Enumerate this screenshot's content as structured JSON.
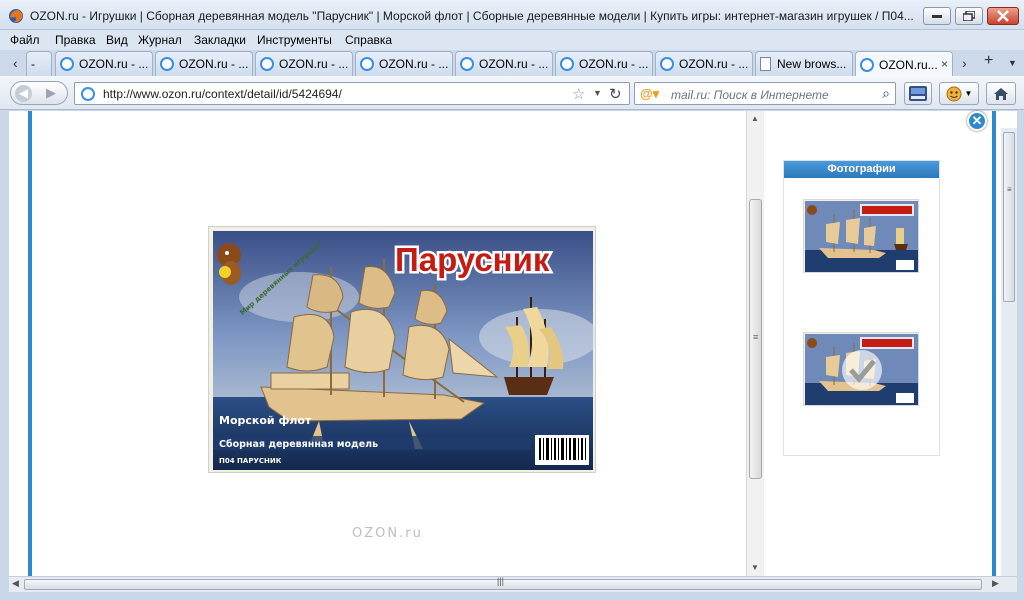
{
  "window": {
    "title": "OZON.ru - Игрушки | Сборная деревянная модель \"Парусник\" | Морской флот | Сборные деревянные модели | Купить игры: интернет-магазин игрушек / П04..."
  },
  "menu": [
    "Файл",
    "Правка",
    "Вид",
    "Журнал",
    "Закладки",
    "Инструменты",
    "Справка"
  ],
  "tabs": [
    {
      "label": "-",
      "type": "ozon"
    },
    {
      "label": "OZON.ru - ...",
      "type": "ozon"
    },
    {
      "label": "OZON.ru - ...",
      "type": "ozon"
    },
    {
      "label": "OZON.ru - ...",
      "type": "ozon"
    },
    {
      "label": "OZON.ru - ...",
      "type": "ozon"
    },
    {
      "label": "OZON.ru - ...",
      "type": "ozon"
    },
    {
      "label": "OZON.ru - ...",
      "type": "ozon"
    },
    {
      "label": "OZON.ru - ...",
      "type": "ozon"
    },
    {
      "label": "New brows...",
      "type": "doc"
    },
    {
      "label": "OZON.ru...",
      "type": "ozon",
      "active": true
    }
  ],
  "tab_controls": {
    "new_tab": "+",
    "close": "×"
  },
  "navbar": {
    "url": "http://www.ozon.ru/context/detail/id/5424694/",
    "search_placeholder": "mail.ru: Поиск в Интернете"
  },
  "viewer": {
    "photos_header": "Фотографии",
    "close_symbol": "✕",
    "watermark": "OZON.ru"
  },
  "product_box": {
    "title": "Парусник",
    "brand": "Мир деревянных игрушек",
    "series": "Морской флот",
    "subtitle": "Сборная деревянная модель",
    "code": "П04 ПАРУСНИК"
  },
  "colors": {
    "accent_blue": "#2c89cf",
    "title_red": "#c41b12"
  }
}
